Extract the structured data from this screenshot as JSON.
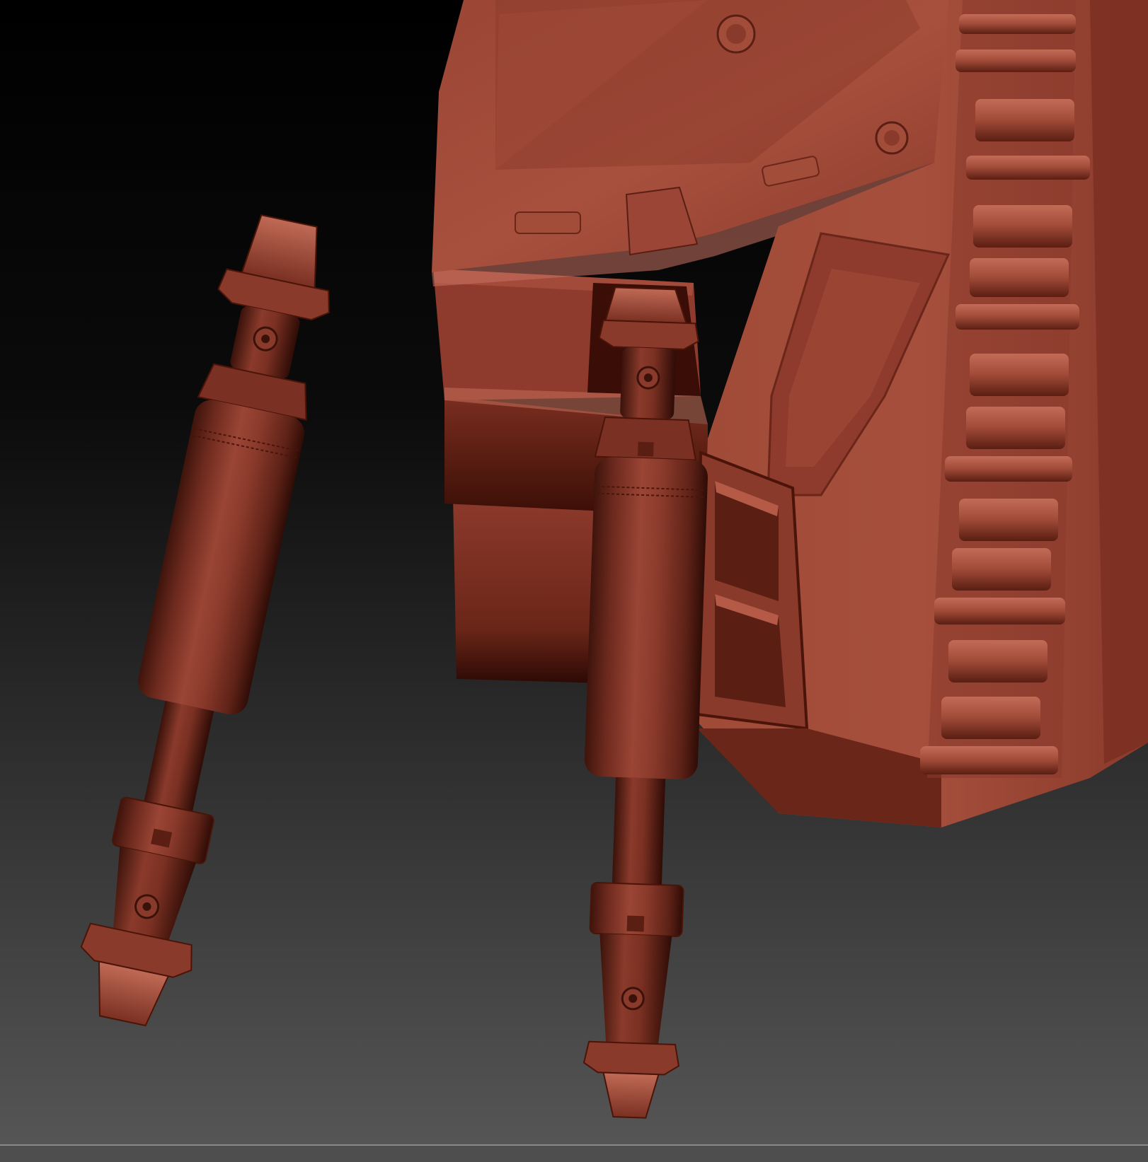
{
  "viewport": {
    "background_top": "#000000",
    "background_bottom": "#565656",
    "bottom_rule": "#8a8a8a"
  },
  "material": {
    "base": "#8e3a2c",
    "mid": "#6e2a1e",
    "light": "#b45a47",
    "dark": "#3e140c",
    "shadow": "#240804"
  },
  "objects": [
    {
      "name": "armor-shell"
    },
    {
      "name": "hydraulic-piston-left"
    },
    {
      "name": "hydraulic-piston-center"
    }
  ]
}
